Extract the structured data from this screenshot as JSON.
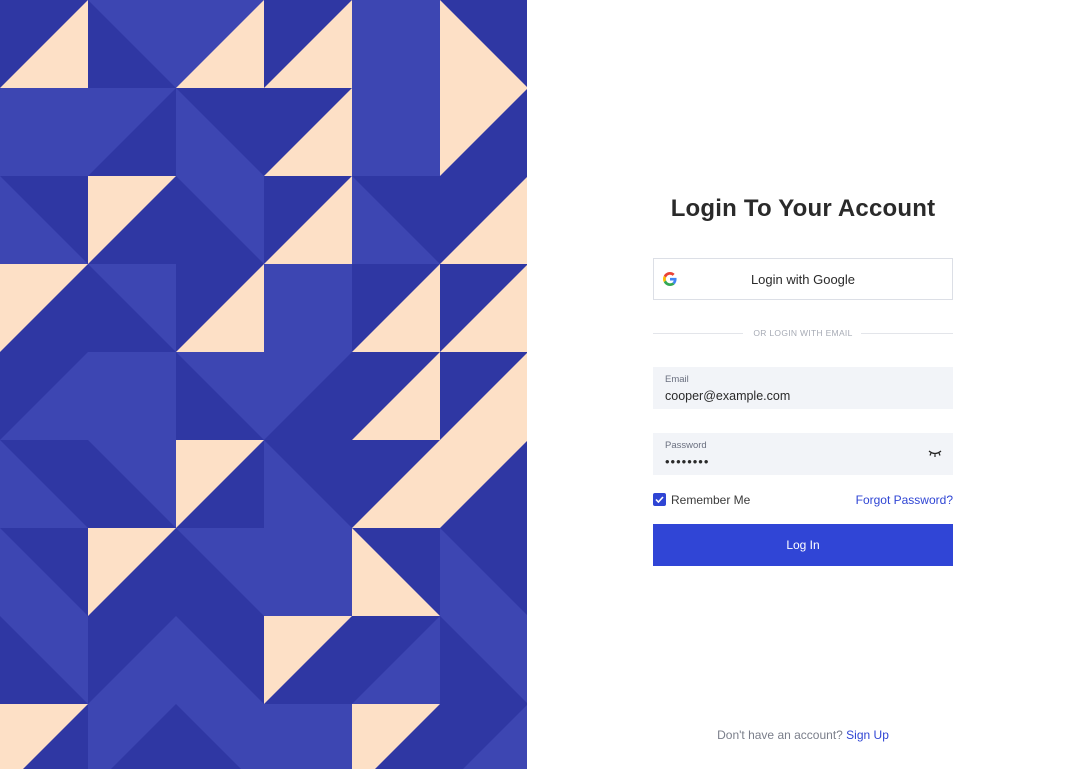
{
  "login": {
    "title": "Login To Your Account",
    "google_label": "Login with Google",
    "divider_text": "OR LOGIN WITH EMAIL",
    "email": {
      "label": "Email",
      "value": "cooper@example.com"
    },
    "password": {
      "label": "Password",
      "value": "••••••••"
    },
    "remember_label": "Remember Me",
    "remember_checked": true,
    "forgot_label": "Forgot Password?",
    "submit_label": "Log In",
    "signup_prompt": "Don't have an account?",
    "signup_link": "Sign Up"
  },
  "colors": {
    "accent": "#3045d6",
    "art_dark": "#2f37a3",
    "art_mid": "#3d46b2",
    "art_peach": "#fde0c6",
    "field_bg": "#f2f4f8"
  },
  "icons": {
    "google": "google-logo-icon",
    "password_toggle": "eye-closed-icon",
    "checkbox": "check-icon"
  }
}
